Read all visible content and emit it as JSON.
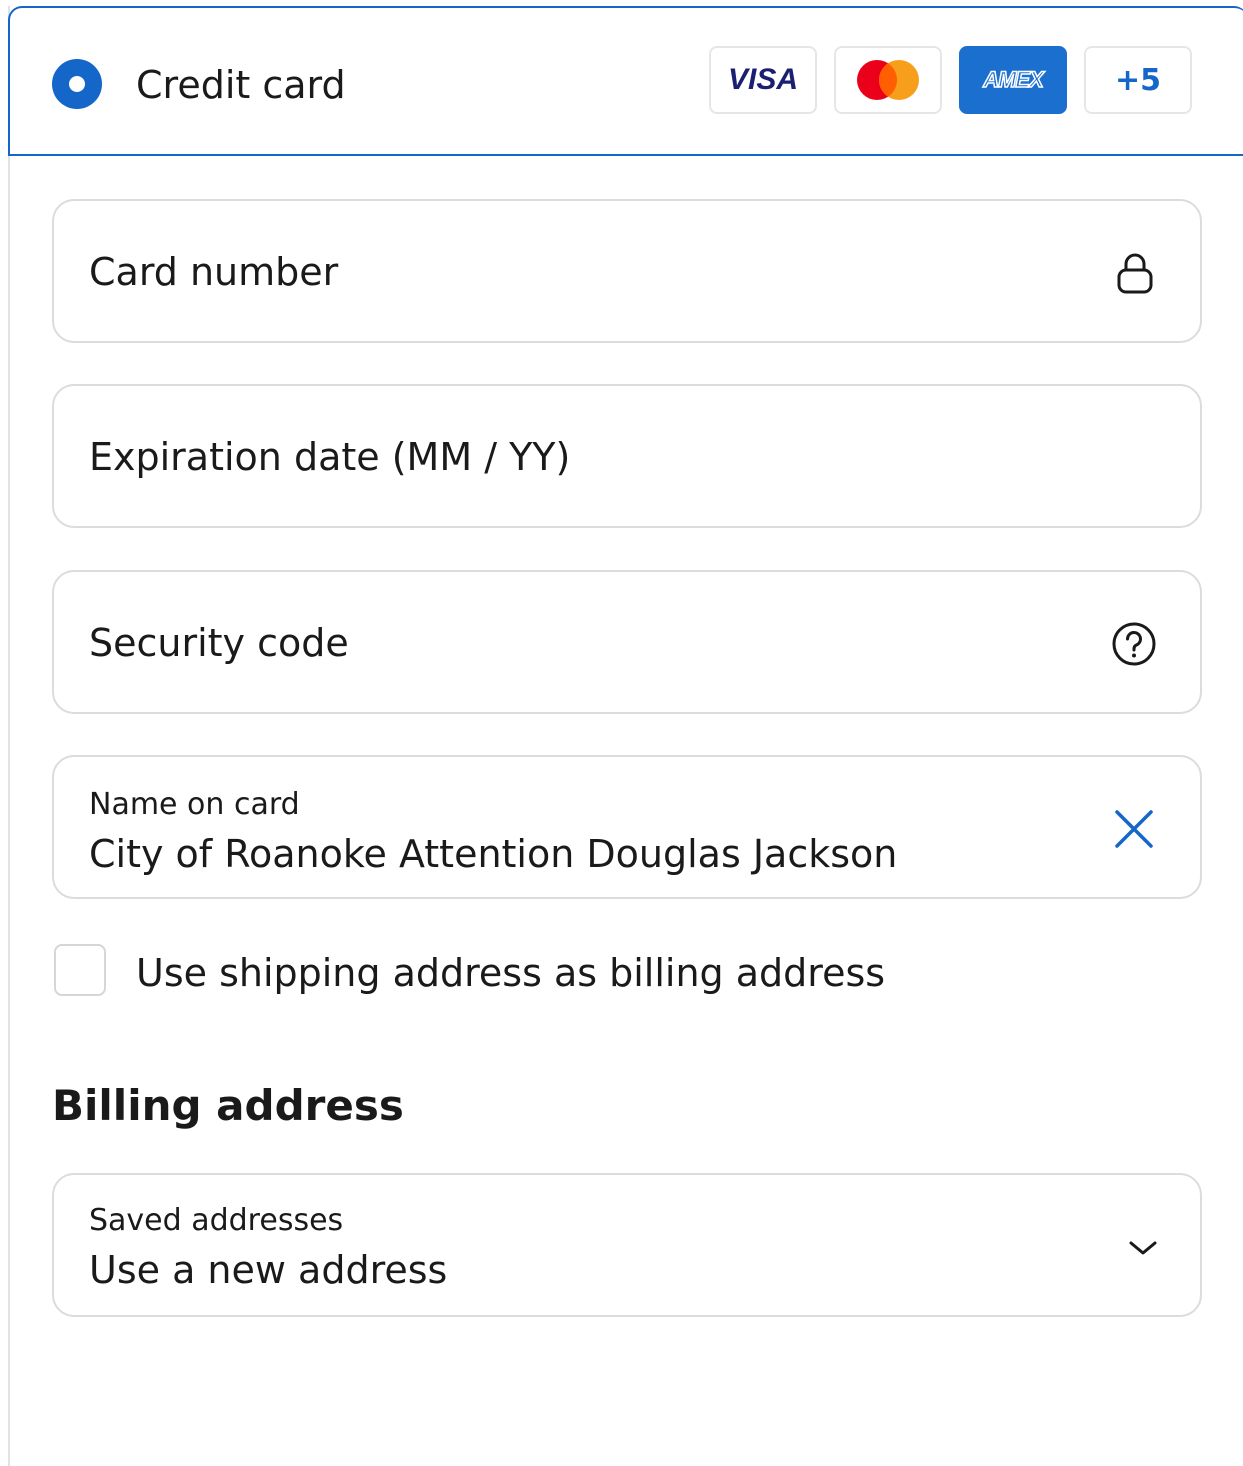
{
  "payment_method": {
    "label": "Credit card",
    "selected": true,
    "brands": {
      "visa": "VISA",
      "amex": "AMEX",
      "more": "+5"
    },
    "icons": [
      "visa-logo-icon",
      "mastercard-logo-icon",
      "amex-logo-icon"
    ]
  },
  "fields": {
    "card_number": {
      "placeholder": "Card number",
      "icon": "lock-icon"
    },
    "expiration": {
      "placeholder": "Expiration date (MM / YY)"
    },
    "security_code": {
      "placeholder": "Security code",
      "icon": "help-circle-icon"
    },
    "name_on_card": {
      "label": "Name on card",
      "value": "City of Roanoke Attention Douglas Jackson",
      "icon": "clear-x-icon"
    }
  },
  "shipping_as_billing": {
    "label": "Use shipping address as billing address",
    "checked": false
  },
  "billing": {
    "heading": "Billing address",
    "saved_addresses": {
      "label": "Saved addresses",
      "value": "Use a new address",
      "icon": "chevron-down-icon"
    }
  },
  "colors": {
    "accent": "#1466c9",
    "border": "#dcdcdc",
    "visa": "#1a1f71",
    "mastercard_red": "#eb001b",
    "mastercard_orange": "#f79e1b",
    "amex": "#1a6fcf"
  }
}
